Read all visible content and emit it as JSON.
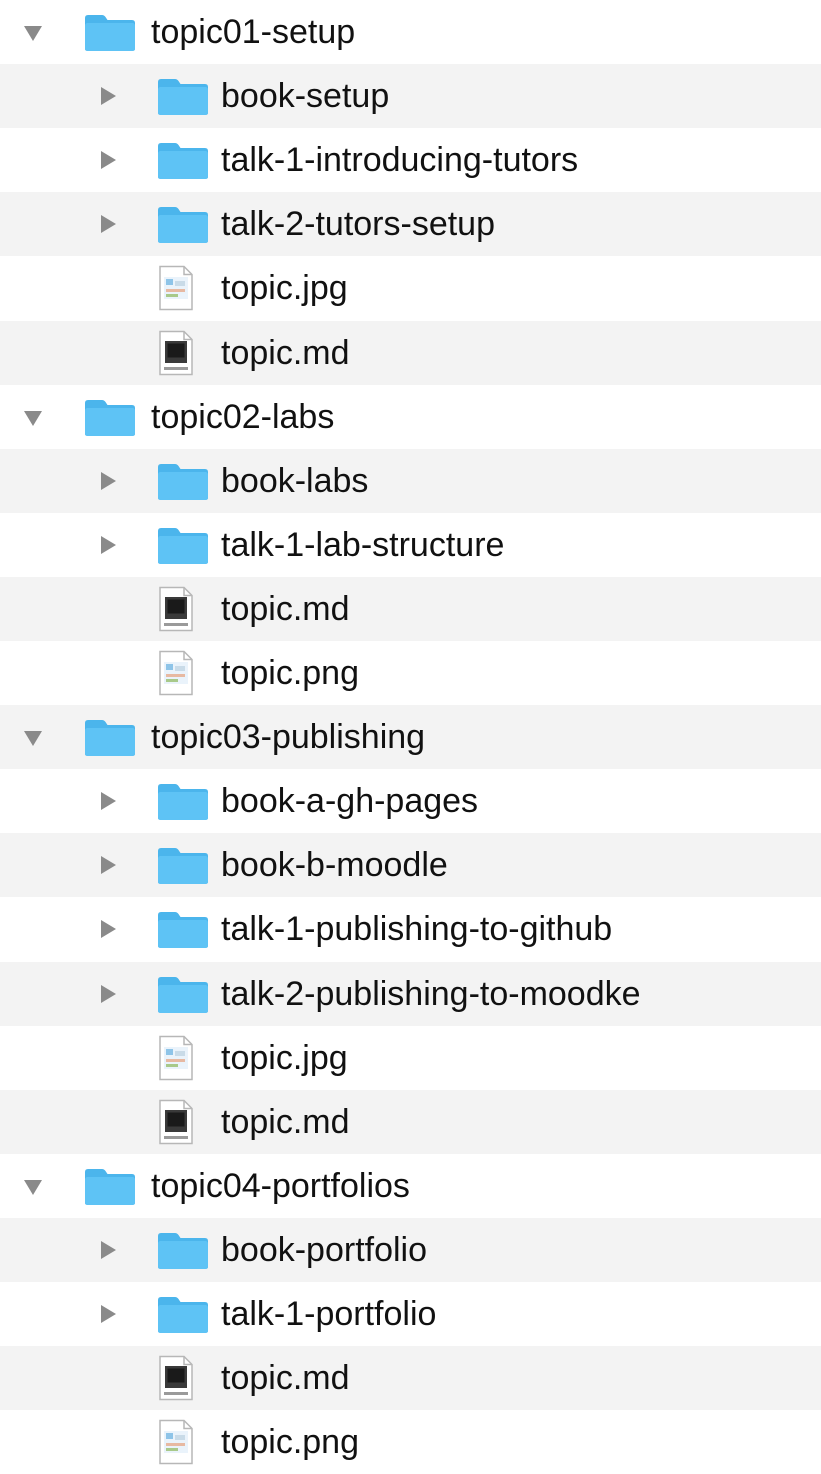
{
  "colors": {
    "folder": "#5ec3f5",
    "folder_tab": "#4bb5ec",
    "disclosure": "#8a8a8a",
    "row_alt": "#f3f3f3",
    "text": "#111111"
  },
  "tree": [
    {
      "level": 0,
      "kind": "folder",
      "expanded": true,
      "label": "topic01-setup"
    },
    {
      "level": 1,
      "kind": "folder",
      "expanded": false,
      "label": "book-setup"
    },
    {
      "level": 1,
      "kind": "folder",
      "expanded": false,
      "label": "talk-1-introducing-tutors"
    },
    {
      "level": 1,
      "kind": "folder",
      "expanded": false,
      "label": "talk-2-tutors-setup"
    },
    {
      "level": 1,
      "kind": "image-file",
      "icon": "image-file-icon",
      "label": "topic.jpg"
    },
    {
      "level": 1,
      "kind": "markdown-file",
      "icon": "markdown-file-icon",
      "label": "topic.md"
    },
    {
      "level": 0,
      "kind": "folder",
      "expanded": true,
      "label": "topic02-labs"
    },
    {
      "level": 1,
      "kind": "folder",
      "expanded": false,
      "label": "book-labs"
    },
    {
      "level": 1,
      "kind": "folder",
      "expanded": false,
      "label": "talk-1-lab-structure"
    },
    {
      "level": 1,
      "kind": "markdown-file",
      "icon": "markdown-file-icon",
      "label": "topic.md"
    },
    {
      "level": 1,
      "kind": "image-file",
      "icon": "image-file-icon",
      "label": "topic.png"
    },
    {
      "level": 0,
      "kind": "folder",
      "expanded": true,
      "label": "topic03-publishing"
    },
    {
      "level": 1,
      "kind": "folder",
      "expanded": false,
      "label": "book-a-gh-pages"
    },
    {
      "level": 1,
      "kind": "folder",
      "expanded": false,
      "label": "book-b-moodle"
    },
    {
      "level": 1,
      "kind": "folder",
      "expanded": false,
      "label": "talk-1-publishing-to-github"
    },
    {
      "level": 1,
      "kind": "folder",
      "expanded": false,
      "label": "talk-2-publishing-to-moodke"
    },
    {
      "level": 1,
      "kind": "image-file",
      "icon": "image-file-icon",
      "label": "topic.jpg"
    },
    {
      "level": 1,
      "kind": "markdown-file",
      "icon": "markdown-file-icon",
      "label": "topic.md"
    },
    {
      "level": 0,
      "kind": "folder",
      "expanded": true,
      "label": "topic04-portfolios"
    },
    {
      "level": 1,
      "kind": "folder",
      "expanded": false,
      "label": "book-portfolio"
    },
    {
      "level": 1,
      "kind": "folder",
      "expanded": false,
      "label": "talk-1-portfolio"
    },
    {
      "level": 1,
      "kind": "markdown-file",
      "icon": "markdown-file-icon",
      "label": "topic.md"
    },
    {
      "level": 1,
      "kind": "image-file",
      "icon": "image-file-icon",
      "label": "topic.png"
    }
  ]
}
